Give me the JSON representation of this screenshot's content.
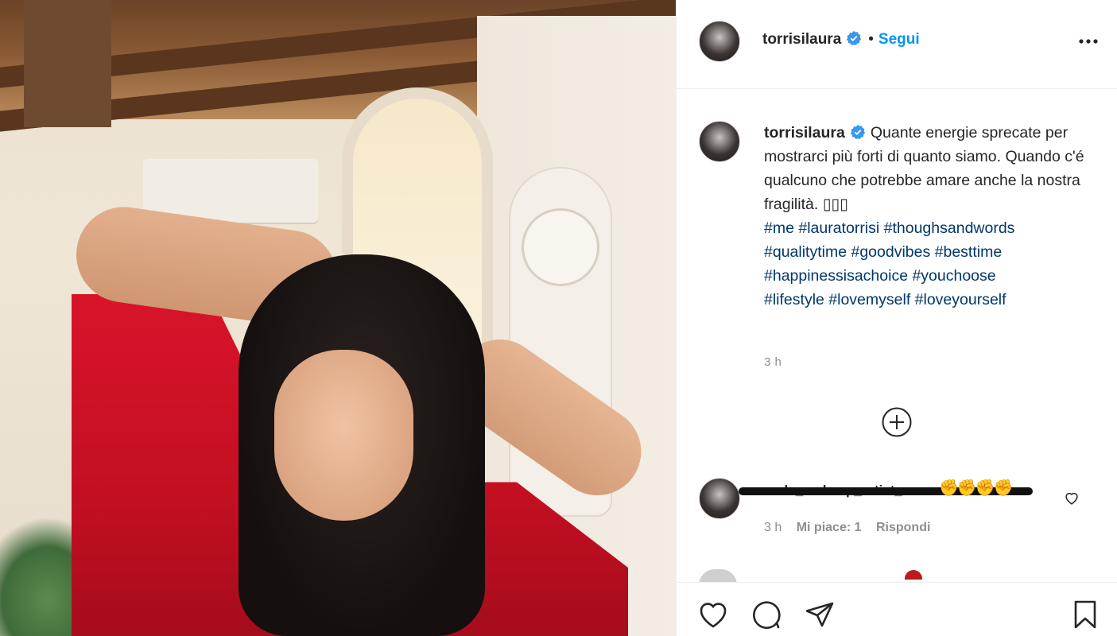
{
  "post": {
    "username": "torrisilaura",
    "follow_label": "Segui",
    "dot": "•",
    "verified_icon": "verified-badge-icon",
    "caption": {
      "text": "Quante energie sprecate per mostrarci più forti di quanto siamo. Quando c'é qualcuno che potrebbe amare anche la nostra fragilità. ▯▯▯",
      "hashtags_line1": "#me #lauratorrisi #thoughsandwords",
      "hashtags_line2": "#qualitytime #goodvibes #besttime",
      "hashtags_line3": "#happinessisachoice #youchoose",
      "hashtags_line4": "#lifestyle #lovemyself #loveyourself"
    },
    "time": "3 h"
  },
  "comment": {
    "username": "carla_makeup_artist_",
    "emojis": "✊✊✊✊",
    "time": "3 h",
    "likes": "Mi piace: 1",
    "reply": "Rispondi"
  },
  "colors": {
    "link_blue": "#0095f6",
    "hashtag": "#00376b",
    "muted": "#8e8e8e"
  },
  "icons": [
    "more-options-icon",
    "add-comment-icon",
    "heart-icon",
    "comment-icon",
    "share-icon",
    "bookmark-icon"
  ]
}
